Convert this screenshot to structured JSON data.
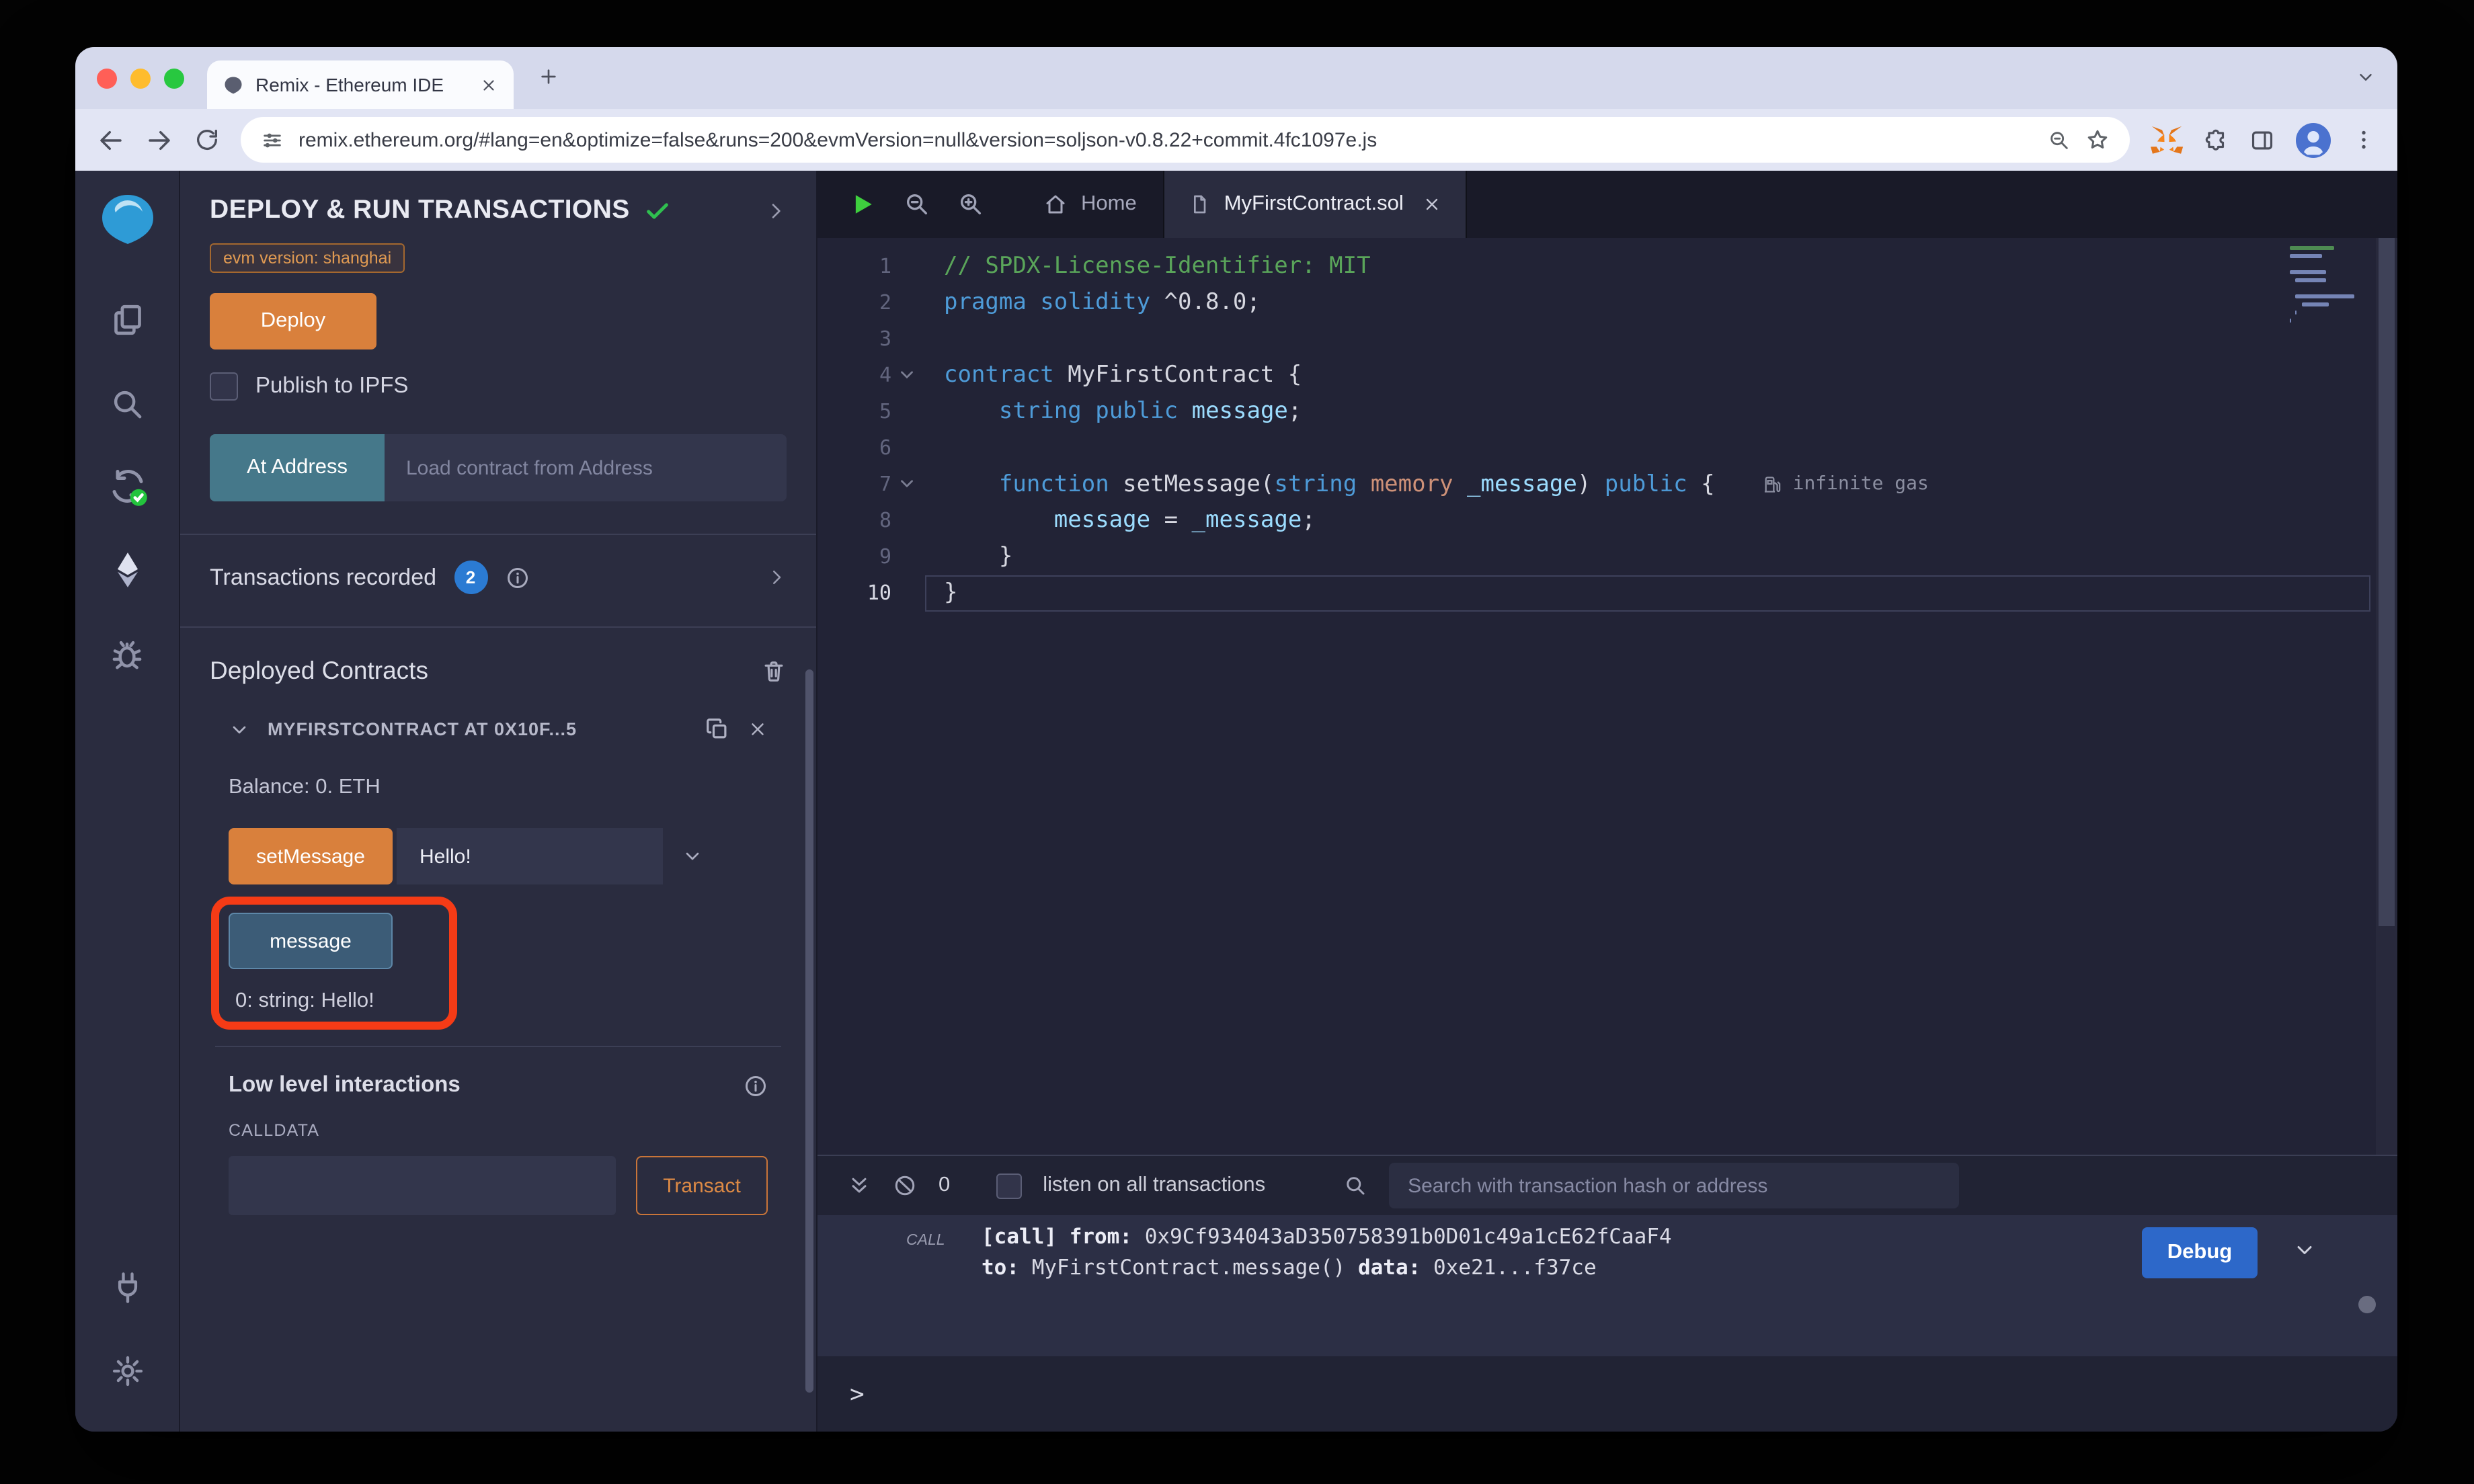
{
  "colors": {
    "orange": "#d9803c",
    "orange_border": "#c97539",
    "teal": "#45788a",
    "badge_blue": "#2b7bd3",
    "debug_blue": "#2d68c9",
    "annotation_red": "#f53b16",
    "success_green": "#2fbf4f",
    "syn_keyword": "#4e9bd8",
    "syn_variable": "#9cdcfe",
    "syn_memory": "#ce9178",
    "syn_comment": "#5aa55a",
    "syn_plain": "#d6d7e0"
  },
  "browser": {
    "tab_title": "Remix - Ethereum IDE",
    "url": "remix.ethereum.org/#lang=en&optimize=false&runs=200&evmVersion=null&version=soljson-v0.8.22+commit.4fc1097e.js"
  },
  "side_panel": {
    "title": "DEPLOY & RUN TRANSACTIONS",
    "evm_version_badge": "evm version: shanghai",
    "deploy_button": "Deploy",
    "publish_checkbox_label": "Publish to IPFS",
    "at_address_button": "At Address",
    "at_address_placeholder": "Load contract from Address",
    "transactions_recorded": "Transactions recorded",
    "transactions_count": "2",
    "deployed_contracts_title": "Deployed Contracts",
    "contract": {
      "header": "MYFIRSTCONTRACT AT 0X10F...5",
      "balance": "Balance: 0. ETH",
      "set_message_button": "setMessage",
      "set_message_value": "Hello!",
      "message_button": "message",
      "message_output": "0: string: Hello!"
    },
    "low_level_title": "Low level interactions",
    "calldata_label": "CALLDATA",
    "transact_button": "Transact"
  },
  "editor": {
    "tab_home": "Home",
    "tab_file": "MyFirstContract.sol",
    "gas_annotation": "infinite gas",
    "code_lines": [
      {
        "n": "1",
        "tokens": [
          {
            "c": "com",
            "t": "// SPDX-License-Identifier: MIT"
          }
        ]
      },
      {
        "n": "2",
        "tokens": [
          {
            "c": "kw",
            "t": "pragma solidity"
          },
          {
            "c": "pl",
            "t": " ^0.8.0;"
          }
        ]
      },
      {
        "n": "3",
        "tokens": []
      },
      {
        "n": "4",
        "fold": true,
        "tokens": [
          {
            "c": "kw",
            "t": "contract"
          },
          {
            "c": "pl",
            "t": " MyFirstContract {"
          }
        ]
      },
      {
        "n": "5",
        "tokens": [
          {
            "c": "pl",
            "t": "    "
          },
          {
            "c": "kw",
            "t": "string"
          },
          {
            "c": "pl",
            "t": " "
          },
          {
            "c": "kw",
            "t": "public"
          },
          {
            "c": "pl",
            "t": " "
          },
          {
            "c": "var",
            "t": "message"
          },
          {
            "c": "pl",
            "t": ";"
          }
        ]
      },
      {
        "n": "6",
        "tokens": []
      },
      {
        "n": "7",
        "fold": true,
        "gas": true,
        "tokens": [
          {
            "c": "pl",
            "t": "    "
          },
          {
            "c": "kw",
            "t": "function"
          },
          {
            "c": "pl",
            "t": " setMessage("
          },
          {
            "c": "kw",
            "t": "string"
          },
          {
            "c": "pl",
            "t": " "
          },
          {
            "c": "mem",
            "t": "memory"
          },
          {
            "c": "pl",
            "t": " "
          },
          {
            "c": "var",
            "t": "_message"
          },
          {
            "c": "pl",
            "t": ") "
          },
          {
            "c": "kw",
            "t": "public"
          },
          {
            "c": "pl",
            "t": " {"
          }
        ]
      },
      {
        "n": "8",
        "tokens": [
          {
            "c": "pl",
            "t": "        "
          },
          {
            "c": "var",
            "t": "message"
          },
          {
            "c": "pl",
            "t": " = "
          },
          {
            "c": "var",
            "t": "_message"
          },
          {
            "c": "pl",
            "t": ";"
          }
        ]
      },
      {
        "n": "9",
        "tokens": [
          {
            "c": "pl",
            "t": "    }"
          }
        ]
      },
      {
        "n": "10",
        "current": true,
        "tokens": [
          {
            "c": "pl",
            "t": "}"
          }
        ]
      }
    ]
  },
  "terminal": {
    "count": "0",
    "listen_label": "listen on all transactions",
    "search_placeholder": "Search with transaction hash or address",
    "log": {
      "badge": "CALL",
      "call_key": "[call]",
      "from_key": "from:",
      "from_value": "0x9Cf934043aD350758391b0D01c49a1cE62fCaaF4",
      "to_key": "to:",
      "to_value": "MyFirstContract.message()",
      "data_key": "data:",
      "data_value": "0xe21...f37ce"
    },
    "debug_button": "Debug",
    "prompt": ">"
  }
}
